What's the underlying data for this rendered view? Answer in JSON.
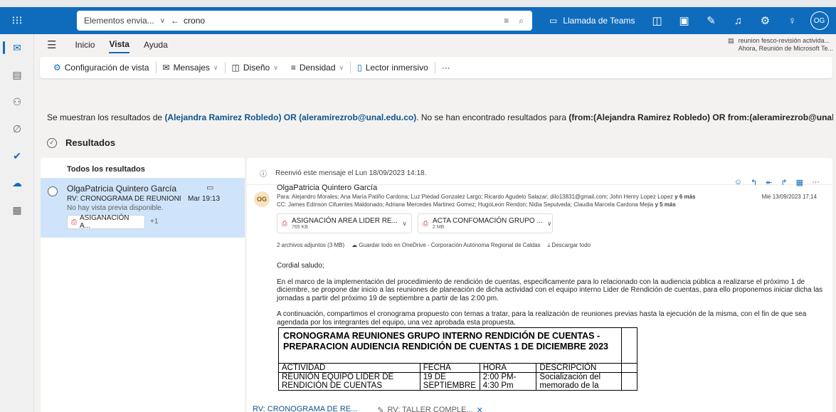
{
  "search": {
    "scope": "Elementos envia...",
    "query": "crono",
    "teams_label": "Llamada de Teams",
    "avatar_initials": "OG"
  },
  "ribbon": {
    "tabs": [
      "Inicio",
      "Vista",
      "Ayuda"
    ],
    "active_tab": "Vista",
    "tools": {
      "view_settings": "Configuración de vista",
      "messages": "Mensajes",
      "layout": "Diseño",
      "density": "Densidad",
      "immersive": "Lector inmersivo",
      "more": "···"
    },
    "reminder_title": "reunion fesco-revisión activida...",
    "reminder_sub": "Ahora, Reunión de Microsoft Te..."
  },
  "notice": {
    "prefix": "Se muestran los resultados de",
    "query1": "(Alejandra Ramirez Robledo) OR (aleramirezrob@unal.edu.co)",
    "middle": ". No se han encontrado resultados para",
    "query2": "(from:(Alejandra Ramirez Robledo) OR from:(aleramirezrob@unal.edu.co))",
    "suffix": "."
  },
  "results_label": "Resultados",
  "list": {
    "header": "Todos los resultados",
    "message": {
      "from": "OlgaPatricia Quintero García",
      "subject": "RV: CRONOGRAMA DE REUNIONE...",
      "time": "Mar 19:13",
      "preview": "No hay vista previa disponible.",
      "attachment": "ASIGANACIÓN A...",
      "more": "+1"
    }
  },
  "reading": {
    "forwarded": "Reenvió este mensaje el Lun 18/09/2023 14:18.",
    "avatar": "OG",
    "sender": "OlgaPatricia Quintero García",
    "to_label": "Para:",
    "to": "Alejandro Morales;  Ana María Patiño Cardona;  Luz Piedad Gonzalez Largo;  Ricardo Agudelo Salazar;  dilo13831@gmail.com;  John Henry Lopez Lopez",
    "to_more": "y 6 más",
    "cc_label": "CC:",
    "cc": "James Edinson Cifuentes Maldonado;  Adriana Mercedes Martinez Gomez;  HugoLeon Rendon;  Nidia Sepulveda;  Claudia Marcela Cardona Mejia",
    "cc_more": "y 5 más",
    "date": "Mié 13/09/2023 17:14",
    "attachments": [
      {
        "name": "ASIGNACIÓN AREA LIDER RE...",
        "size": "765 KB"
      },
      {
        "name": "ACTA CONFOMACIÓN GRUPO ...",
        "size": "2 MB"
      }
    ],
    "att_summary": "2 archivos adjuntos (3 MB)",
    "save_onedrive": "Guardar todo en OneDrive - Corporación Autónoma Regional de Caldas",
    "download_all": "Descargar todo",
    "greeting": "Cordial saludo;",
    "para1": "En el marco de la implementación del procedimiento de rendición de cuentas, especificamente para lo relacionado con la audiencia pública a realizarse el próximo 1 de diciembre, se propone dar inicio a las reuniones de planeación de dicha actividad con el equipo interno Lider de Rendición de cuentas, para ello proponemos iniciar dicha las jornadas a partir del próximo 19 de septiembre a partir de las 2:00 pm.",
    "para2": "A continuación, compartimos el cronograma propuesto con temas a tratar, para la realización de reuniones previas hasta la ejecución de la misma, con el fin de que sea agendada por los integrantes del equipo, una vez aprobada esta propuesta.",
    "table": {
      "title": "CRONOGRAMA REUNIONES GRUPO INTERNO RENDICIÓN DE CUENTAS - PREPARACION AUDIENCIA RENDICIÓN DE CUENTAS 1 DE DICIEMBRE 2023",
      "headers": [
        "ACTIVIDAD",
        "FECHA",
        "HORA",
        "DESCRIPCIÓN"
      ],
      "row1": [
        "REUNIÓN EQUIPO LIDER DE RENDICIÓN DE CUENTAS",
        "19 DE SEPTIEMBRE",
        "2:00 PM- 4:30 Pm",
        "Socialización del memorado de la"
      ]
    }
  },
  "bottom_tabs": [
    "RV: CRONOGRAMA DE RE...",
    "RV: TALLER COMPLE..."
  ],
  "colors": {
    "accent": "#0f6cbd",
    "selected": "#cfe4fa"
  }
}
